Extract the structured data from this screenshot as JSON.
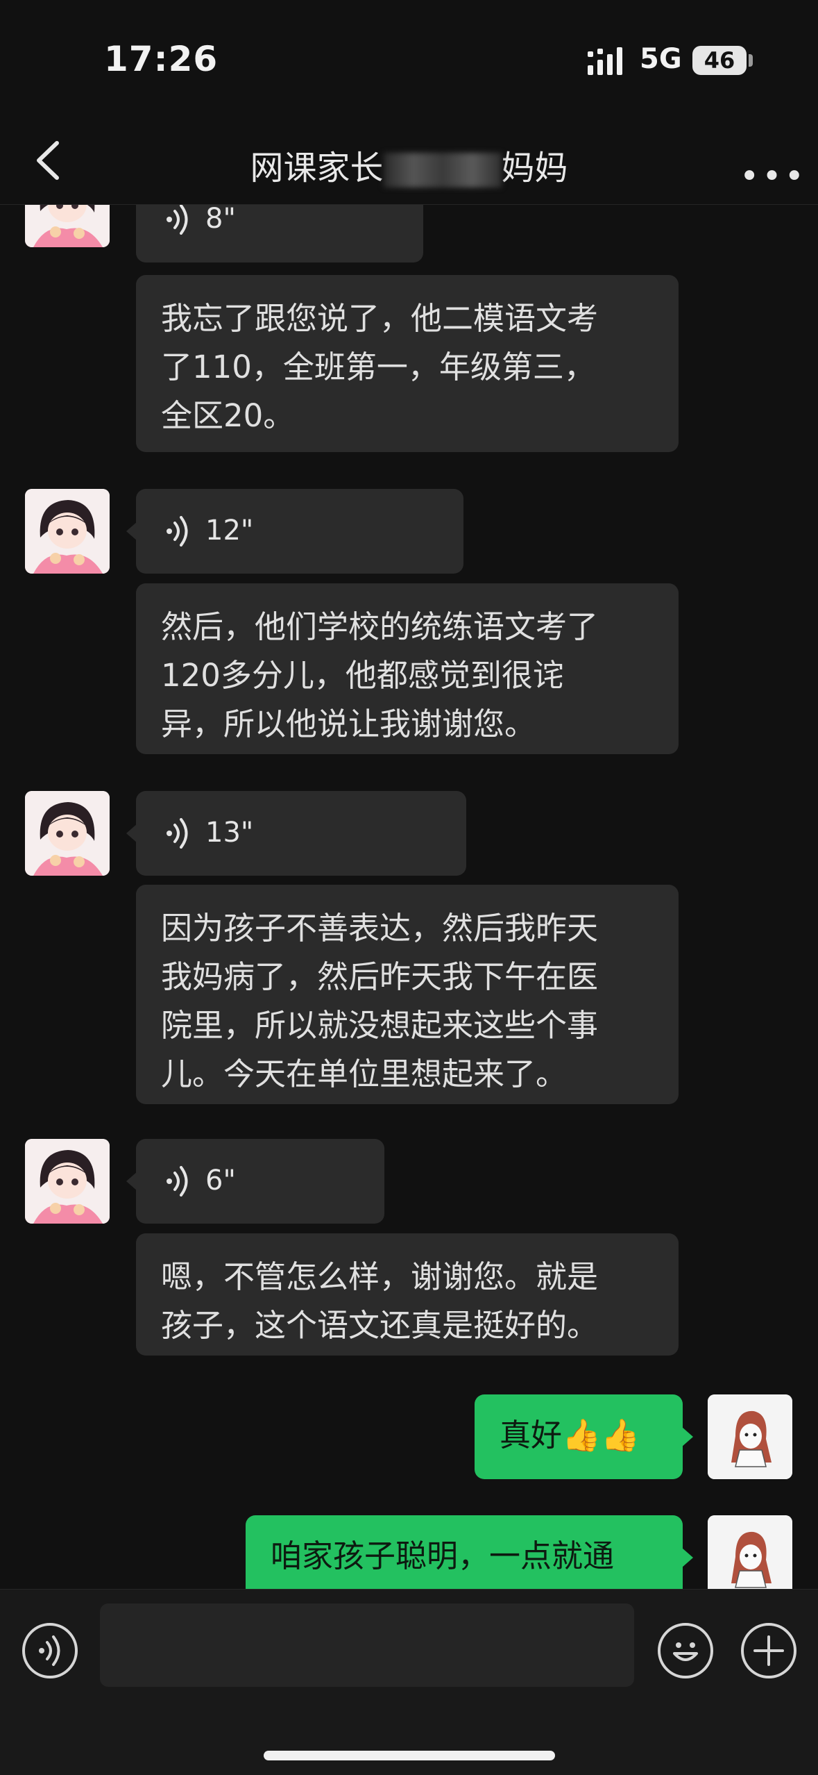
{
  "status_bar": {
    "time": "17:26",
    "network": "5G",
    "battery": "46"
  },
  "nav": {
    "title_prefix": "网课家长",
    "title_suffix": "妈妈",
    "back_icon": "chevron-left-icon",
    "more_icon": "more-dots-icon"
  },
  "messages": [
    {
      "sender": "other",
      "type": "voice",
      "duration": "8\""
    },
    {
      "sender": "other",
      "type": "text",
      "lines": [
        "我忘了跟您说了，他二模语文考",
        "了110，全班第一，年级第三，",
        "全区20。"
      ]
    },
    {
      "sender": "other",
      "type": "voice",
      "duration": "12\""
    },
    {
      "sender": "other",
      "type": "text",
      "lines": [
        "然后，他们学校的统练语文考了",
        "120多分儿，他都感觉到很诧",
        "异，所以他说让我谢谢您。"
      ]
    },
    {
      "sender": "other",
      "type": "voice",
      "duration": "13\""
    },
    {
      "sender": "other",
      "type": "text",
      "lines": [
        "因为孩子不善表达，然后我昨天",
        "我妈病了，然后昨天我下午在医",
        "院里，所以就没想起来这些个事",
        "儿。今天在单位里想起来了。"
      ]
    },
    {
      "sender": "other",
      "type": "voice",
      "duration": "6\""
    },
    {
      "sender": "other",
      "type": "text",
      "lines": [
        "嗯，不管怎么样，谢谢您。就是",
        "孩子，这个语文还真是挺好的。"
      ]
    },
    {
      "sender": "me",
      "type": "text",
      "text": "真好👍👍"
    },
    {
      "sender": "me",
      "type": "text",
      "text": "咱家孩子聪明，一点就通"
    }
  ],
  "colors": {
    "background": "#111111",
    "bubble_other": "#2b2b2b",
    "bubble_me": "#23c160"
  }
}
